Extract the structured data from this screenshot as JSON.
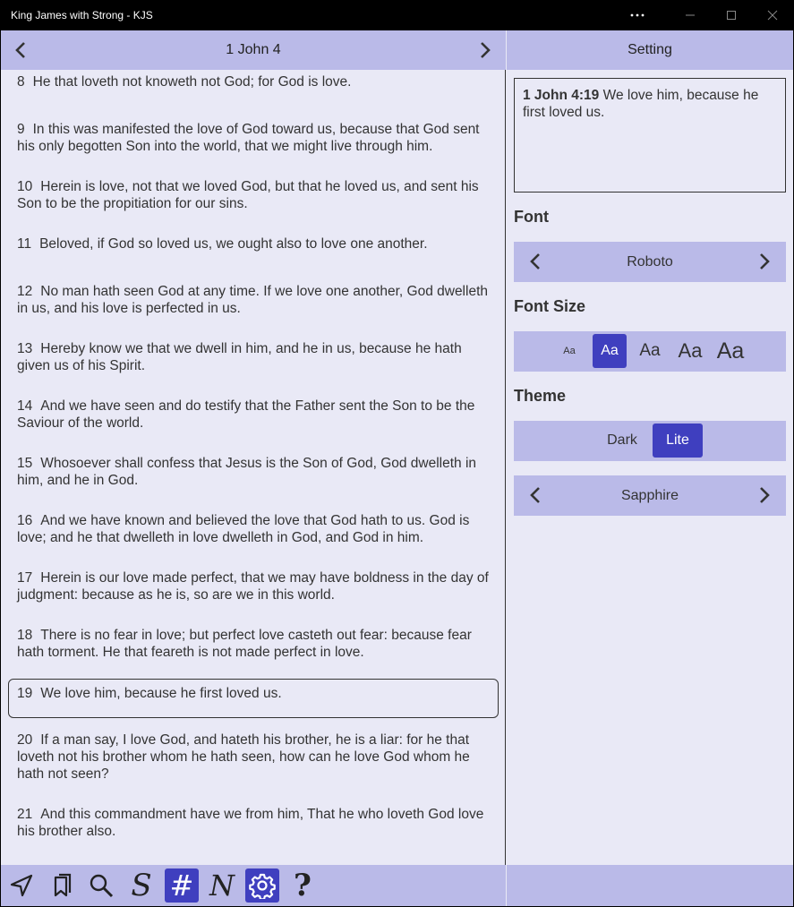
{
  "window": {
    "title": "King James with Strong - KJS"
  },
  "nav": {
    "chapter": "1 John 4"
  },
  "verses": [
    {
      "num": "8",
      "text": "He that loveth not knoweth not God; for God is love."
    },
    {
      "num": "9",
      "text": "In this was manifested the love of God toward us, because that God sent his only begotten Son into the world, that we might live through him."
    },
    {
      "num": "10",
      "text": "Herein is love, not that we loved God, but that he loved us, and sent his Son to be the propitiation for our sins."
    },
    {
      "num": "11",
      "text": "Beloved, if God so loved us, we ought also to love one another."
    },
    {
      "num": "12",
      "text": "No man hath seen God at any time. If we love one another, God dwelleth in us, and his love is perfected in us."
    },
    {
      "num": "13",
      "text": "Hereby know we that we dwell in him, and he in us, because he hath given us of his Spirit."
    },
    {
      "num": "14",
      "text": "And we have seen and do testify that the Father sent the Son to be the Saviour of the world."
    },
    {
      "num": "15",
      "text": "Whosoever shall confess that Jesus is the Son of God, God dwelleth in him, and he in God."
    },
    {
      "num": "16",
      "text": "And we have known and believed the love that God hath to us. God is love; and he that dwelleth in love dwelleth in God, and God in him."
    },
    {
      "num": "17",
      "text": "Herein is our love made perfect, that we may have boldness in the day of judgment: because as he is, so are we in this world."
    },
    {
      "num": "18",
      "text": "There is no fear in love; but perfect love casteth out fear: because fear hath torment. He that feareth is not made perfect in love."
    },
    {
      "num": "19",
      "text": "We love him, because he first loved us."
    },
    {
      "num": "20",
      "text": "If a man say, I love God, and hateth his brother, he is a liar: for he that loveth not his brother whom he hath seen, how can he love God whom he hath not seen?"
    },
    {
      "num": "21",
      "text": "And this commandment have we from him, That he who loveth God love his brother also."
    }
  ],
  "selected_verse": "19",
  "toolbar": {
    "tools": [
      "navigate-icon",
      "bookmarks-icon",
      "search-icon",
      "strong-icon",
      "verse-number-icon",
      "notes-icon",
      "settings-icon",
      "help-icon"
    ],
    "strong_glyph": "S",
    "hash_glyph": "#",
    "notes_glyph": "N",
    "help_glyph": "?"
  },
  "settings": {
    "header": "Setting",
    "preview_ref": "1 John 4:19",
    "preview_text": "We love him, because he first loved us.",
    "font_label": "Font",
    "font_value": "Roboto",
    "font_size_label": "Font Size",
    "font_size_options": [
      "Aa",
      "Aa",
      "Aa",
      "Aa",
      "Aa"
    ],
    "font_size_selected": 1,
    "theme_label": "Theme",
    "theme_options": [
      "Dark",
      "Lite"
    ],
    "theme_selected": "Lite",
    "color_scheme": "Sapphire"
  },
  "colors": {
    "accent": "#3f3fbf",
    "bar": "#babae8",
    "background": "#e9e9f6"
  }
}
